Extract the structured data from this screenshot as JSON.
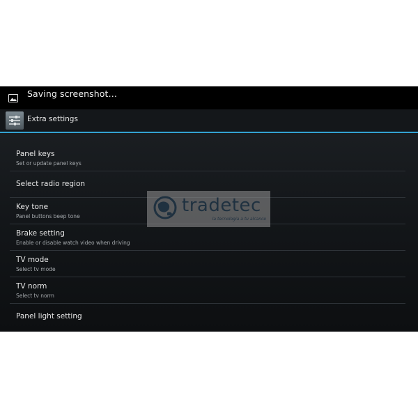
{
  "status_bar": {
    "notification_icon": "image-icon",
    "notification_text": "Saving screenshot…"
  },
  "action_bar": {
    "app_icon": "sliders-settings-icon",
    "title": "Extra settings"
  },
  "settings": [
    {
      "title": "Panel keys",
      "summary": "Set or update panel keys"
    },
    {
      "title": "Select radio region",
      "summary": ""
    },
    {
      "title": "Key tone",
      "summary": "Panel buttons beep tone"
    },
    {
      "title": "Brake setting",
      "summary": "Enable or disable watch video when driving"
    },
    {
      "title": "TV mode",
      "summary": "Select tv mode"
    },
    {
      "title": "TV norm",
      "summary": "Select tv norm"
    },
    {
      "title": "Panel light setting",
      "summary": ""
    }
  ],
  "watermark": {
    "brand": "tradetec",
    "tagline": "la tecnologia a tu alcance",
    "logo_icon": "globe-icon"
  },
  "colors": {
    "accent": "#33a3d2",
    "status_bar_bg": "#000000",
    "list_bg": "#16191c",
    "title_text": "#e8e8e8",
    "summary_text": "#a4a8ac"
  }
}
